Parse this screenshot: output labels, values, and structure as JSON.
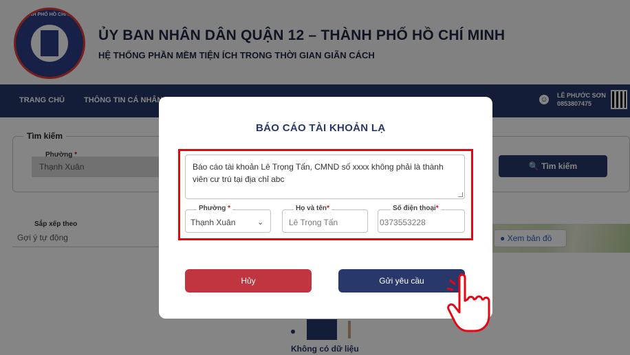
{
  "header": {
    "title": "ỦY BAN NHÂN DÂN QUẬN 12 – THÀNH PHỐ HỒ CHÍ MINH",
    "subtitle": "HỆ THỐNG PHẦN MỀM TIỆN ÍCH TRONG THỜI GIAN GIÃN CÁCH",
    "logo_ring_text": "THÀNH PHỐ HỒ CHÍ MINH"
  },
  "nav": {
    "items": [
      "TRANG CHỦ",
      "THÔNG TIN CÁ NHÂN"
    ],
    "user_name": "LÊ PHƯỚC SƠN",
    "user_phone": "0853807475"
  },
  "search": {
    "legend": "Tìm kiếm",
    "ward_label": "Phường",
    "ward_value": "Thạnh Xuân",
    "button": "Tìm kiếm"
  },
  "sort": {
    "label": "Sắp xếp theo",
    "value": "Gợi ý tự động"
  },
  "map": {
    "button": "Xem bản đồ"
  },
  "empty": {
    "text": "Không có dữ liệu"
  },
  "modal": {
    "title": "BÁO CÁO TÀI KHOẢN LẠ",
    "report_text": "Báo cáo tài khoản Lê Trọng Tấn, CMND số xxxx không phải là thành viên cư trú tại địa chỉ abc",
    "ward_label": "Phường",
    "ward_value": "Thạnh Xuân",
    "name_label": "Họ và tên",
    "name_value": "Lê Trọng Tấn",
    "phone_label": "Số điện thoại",
    "phone_value": "0373553228",
    "cancel_button": "Hủy",
    "send_button": "Gửi yêu cầu"
  },
  "colors": {
    "primary": "#28386a",
    "danger": "#c0353f",
    "highlight": "#e30613"
  }
}
